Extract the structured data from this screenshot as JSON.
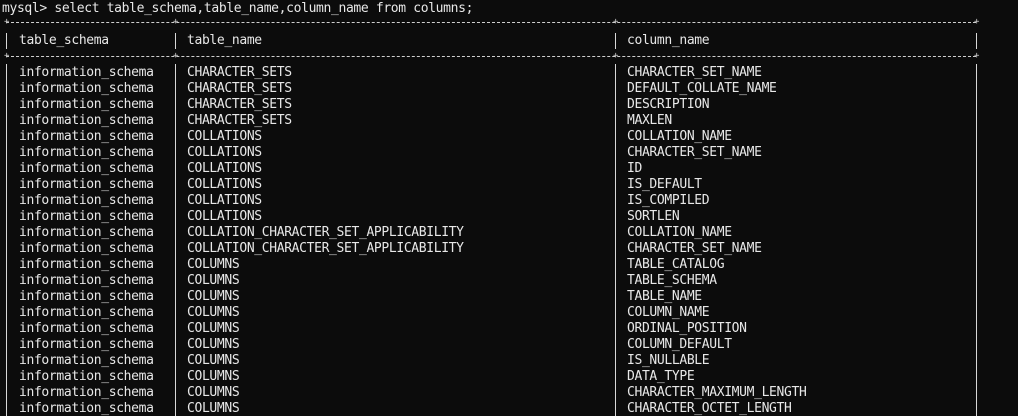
{
  "terminal": {
    "prompt": "mysql>",
    "command": "select table_schema,table_name,column_name from columns;"
  },
  "table": {
    "headers": [
      "table_schema",
      "table_name",
      "column_name"
    ],
    "rows": [
      [
        "information_schema",
        "CHARACTER_SETS",
        "CHARACTER_SET_NAME"
      ],
      [
        "information_schema",
        "CHARACTER_SETS",
        "DEFAULT_COLLATE_NAME"
      ],
      [
        "information_schema",
        "CHARACTER_SETS",
        "DESCRIPTION"
      ],
      [
        "information_schema",
        "CHARACTER_SETS",
        "MAXLEN"
      ],
      [
        "information_schema",
        "COLLATIONS",
        "COLLATION_NAME"
      ],
      [
        "information_schema",
        "COLLATIONS",
        "CHARACTER_SET_NAME"
      ],
      [
        "information_schema",
        "COLLATIONS",
        "ID"
      ],
      [
        "information_schema",
        "COLLATIONS",
        "IS_DEFAULT"
      ],
      [
        "information_schema",
        "COLLATIONS",
        "IS_COMPILED"
      ],
      [
        "information_schema",
        "COLLATIONS",
        "SORTLEN"
      ],
      [
        "information_schema",
        "COLLATION_CHARACTER_SET_APPLICABILITY",
        "COLLATION_NAME"
      ],
      [
        "information_schema",
        "COLLATION_CHARACTER_SET_APPLICABILITY",
        "CHARACTER_SET_NAME"
      ],
      [
        "information_schema",
        "COLUMNS",
        "TABLE_CATALOG"
      ],
      [
        "information_schema",
        "COLUMNS",
        "TABLE_SCHEMA"
      ],
      [
        "information_schema",
        "COLUMNS",
        "TABLE_NAME"
      ],
      [
        "information_schema",
        "COLUMNS",
        "COLUMN_NAME"
      ],
      [
        "information_schema",
        "COLUMNS",
        "ORDINAL_POSITION"
      ],
      [
        "information_schema",
        "COLUMNS",
        "COLUMN_DEFAULT"
      ],
      [
        "information_schema",
        "COLUMNS",
        "IS_NULLABLE"
      ],
      [
        "information_schema",
        "COLUMNS",
        "DATA_TYPE"
      ],
      [
        "information_schema",
        "COLUMNS",
        "CHARACTER_MAXIMUM_LENGTH"
      ],
      [
        "information_schema",
        "COLUMNS",
        "CHARACTER_OCTET_LENGTH"
      ]
    ]
  }
}
